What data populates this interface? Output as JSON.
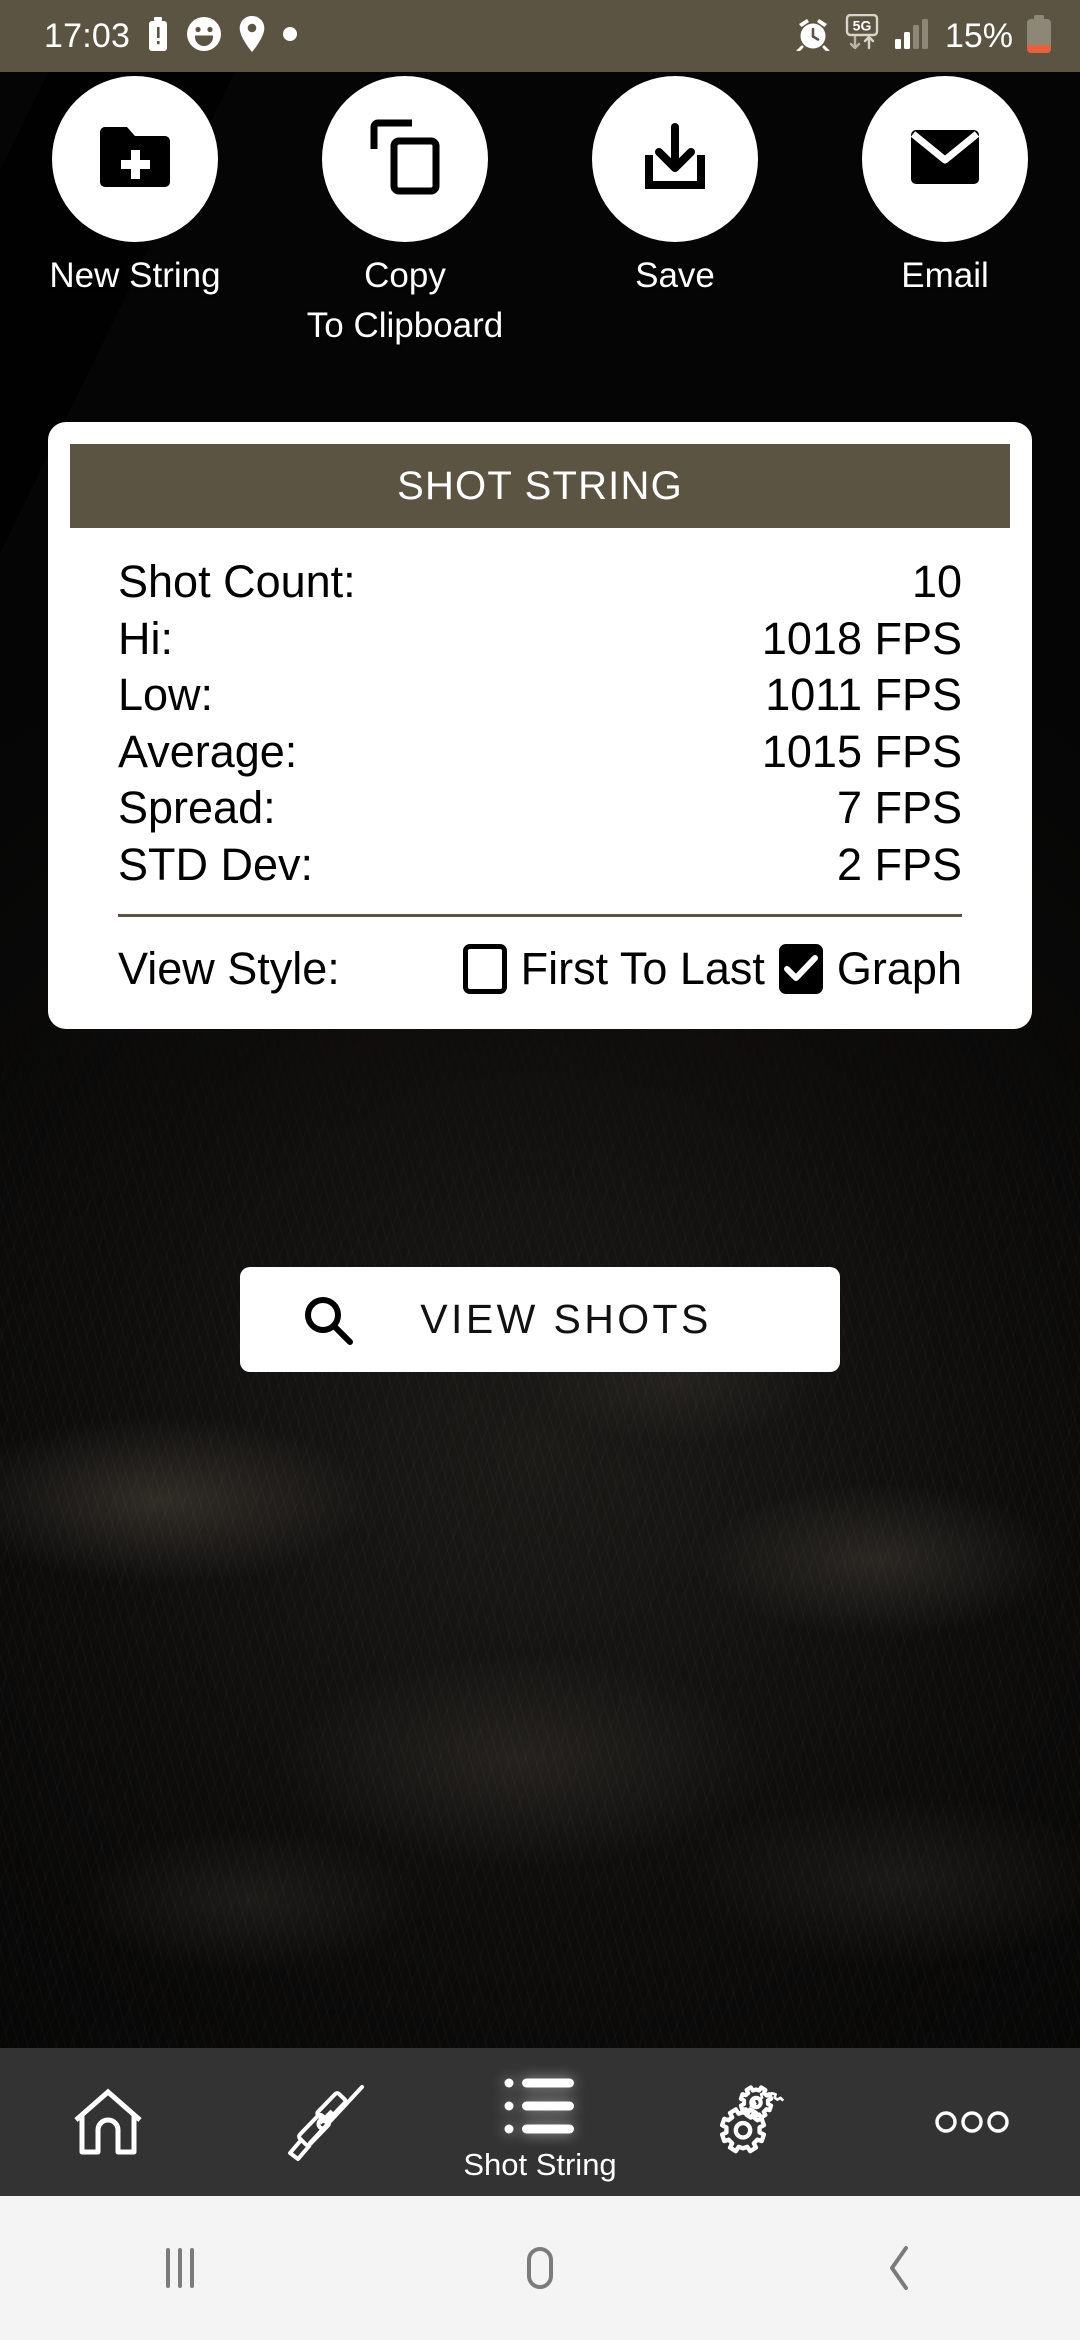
{
  "status_bar": {
    "time": "17:03",
    "battery_percent": "15%",
    "network": "5G",
    "left_icons": [
      "battery-alert-icon",
      "smiley-icon",
      "location-pin-icon",
      "dot-icon"
    ],
    "right_icons": [
      "alarm-icon",
      "5g-data-icon",
      "signal-bars-icon",
      "battery-icon"
    ],
    "bg_color": "#5C5443"
  },
  "actions": [
    {
      "label_lines": [
        "New String"
      ],
      "icon": "folder-plus-icon"
    },
    {
      "label_lines": [
        "Copy",
        "To Clipboard"
      ],
      "icon": "copy-icon"
    },
    {
      "label_lines": [
        "Save"
      ],
      "icon": "download-icon"
    },
    {
      "label_lines": [
        "Email"
      ],
      "icon": "envelope-icon"
    }
  ],
  "card": {
    "title": "SHOT STRING",
    "header_color": "#5C5443",
    "stats": [
      {
        "label": "Shot Count:",
        "value": "10"
      },
      {
        "label": "Hi:",
        "value": "1018 FPS"
      },
      {
        "label": "Low:",
        "value": "1011 FPS"
      },
      {
        "label": "Average:",
        "value": "1015 FPS"
      },
      {
        "label": "Spread:",
        "value": "7 FPS"
      },
      {
        "label": "STD Dev:",
        "value": "2 FPS"
      }
    ],
    "view_style": {
      "label": "View Style:",
      "options": [
        {
          "label": "First To Last",
          "checked": false
        },
        {
          "label": "Graph",
          "checked": true
        }
      ]
    }
  },
  "view_shots_button": {
    "label": "VIEW SHOTS",
    "icon": "search-icon"
  },
  "bottom_nav": {
    "bg_color": "#333333",
    "items": [
      {
        "label": "",
        "icon": "home-icon",
        "active": false
      },
      {
        "label": "",
        "icon": "rifle-icon",
        "active": false
      },
      {
        "label": "Shot String",
        "icon": "list-icon",
        "active": true
      },
      {
        "label": "",
        "icon": "gears-icon",
        "active": false
      },
      {
        "label": "",
        "icon": "more-dots-icon",
        "active": false
      }
    ]
  },
  "system_nav": {
    "bg_color": "#F4F4F4",
    "items": [
      {
        "icon": "recents-icon"
      },
      {
        "icon": "home-button-icon"
      },
      {
        "icon": "back-icon"
      }
    ]
  }
}
